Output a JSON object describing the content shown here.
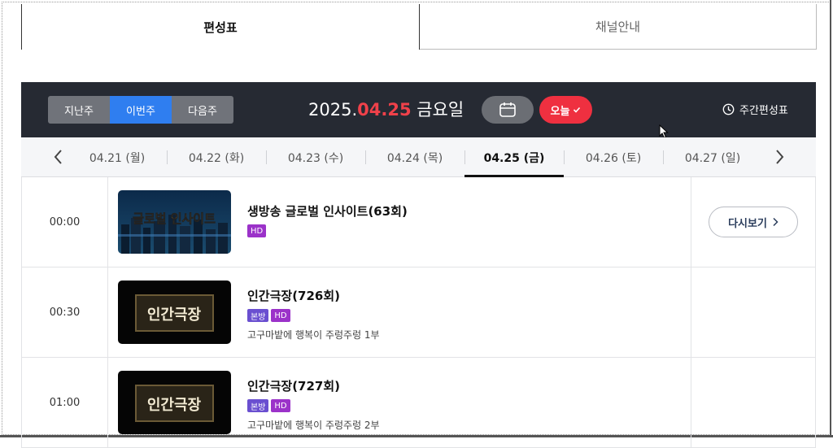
{
  "tabs": [
    {
      "label": "편성표",
      "active": true
    },
    {
      "label": "채널안내",
      "active": false
    }
  ],
  "week_buttons": [
    {
      "label": "지난주",
      "active": false
    },
    {
      "label": "이번주",
      "active": true
    },
    {
      "label": "다음주",
      "active": false
    }
  ],
  "current_date": {
    "year": "2025.",
    "monthday": "04.25",
    "weekday": " 금요일"
  },
  "today_button": {
    "label": "오늘",
    "icon": "check-icon"
  },
  "calendar_button": {
    "icon": "calendar-icon"
  },
  "weekly_schedule": {
    "label": "주간편성표",
    "icon": "clock-icon"
  },
  "dates": [
    {
      "label": "04.21 (월)",
      "selected": false
    },
    {
      "label": "04.22 (화)",
      "selected": false
    },
    {
      "label": "04.23 (수)",
      "selected": false
    },
    {
      "label": "04.24 (목)",
      "selected": false
    },
    {
      "label": "04.25 (금)",
      "selected": true
    },
    {
      "label": "04.26 (토)",
      "selected": false
    },
    {
      "label": "04.27 (일)",
      "selected": false
    }
  ],
  "programs": [
    {
      "time": "00:00",
      "title": "생방송 글로벌 인사이트(63회)",
      "badges": [
        "HD"
      ],
      "description": "",
      "replay_label": "다시보기",
      "thumb_text": "글로벌 인사이트"
    },
    {
      "time": "00:30",
      "title": "인간극장(726회)",
      "badges": [
        "본방",
        "HD"
      ],
      "description": "고구마밭에 행복이 주렁주렁 1부",
      "replay_label": "",
      "thumb_text": "인간극장"
    },
    {
      "time": "01:00",
      "title": "인간극장(727회)",
      "badges": [
        "본방",
        "HD"
      ],
      "description": "고구마밭에 행복이 주렁주렁 2부",
      "replay_label": "",
      "thumb_text": "인간극장"
    }
  ],
  "colors": {
    "accent_red": "#ef3040",
    "accent_blue": "#2f7ef0",
    "dark_bar": "#262a33",
    "hd_badge": "#9b32c9",
    "main_badge": "#6a4fd0"
  }
}
